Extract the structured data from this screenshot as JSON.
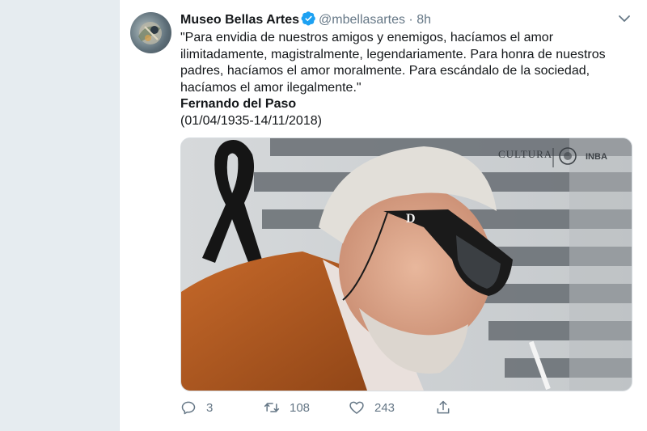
{
  "tweet": {
    "author_name": "Museo Bellas Artes",
    "handle": "@mbellasartes",
    "separator": "·",
    "time": "8h",
    "body_lines": [
      "\"Para envidia de nuestros amigos y enemigos, hacíamos el amor",
      "ilimitadamente, magistralmente, legendariamente. Para honra de nuestros",
      "padres, hacíamos el amor moralmente. Para escándalo de la sociedad,",
      "hacíamos el amor ilegalmente.\""
    ],
    "quote_author": "Fernando del Paso",
    "dates": "(01/04/1935-14/11/2018)"
  },
  "media": {
    "logo_cultura": "CULTURA",
    "logo_inba": "INBA",
    "glasses_mark": "D"
  },
  "actions": {
    "reply_count": "3",
    "retweet_count": "108",
    "like_count": "243"
  },
  "colors": {
    "accent": "#1da1f2",
    "muted": "#657786",
    "text": "#14171a"
  }
}
